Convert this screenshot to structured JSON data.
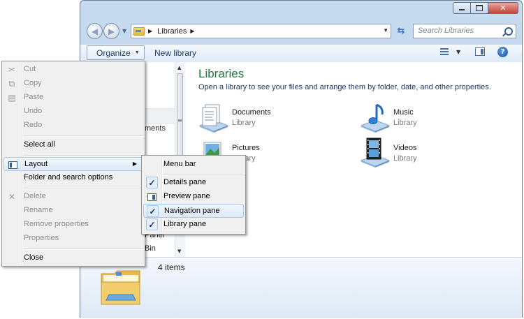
{
  "window": {
    "address_crumb": "Libraries",
    "search_placeholder": "Search Libraries"
  },
  "toolbar": {
    "organize_label": "Organize",
    "new_library_label": "New library"
  },
  "navigation": {
    "fragments": [
      "ments",
      "Panel",
      "Bin"
    ]
  },
  "content": {
    "title": "Libraries",
    "subtitle": "Open a library to see your files and arrange them by folder, date, and other properties.",
    "libraries": [
      {
        "name": "Documents",
        "type": "Library"
      },
      {
        "name": "Music",
        "type": "Library"
      },
      {
        "name": "Pictures",
        "type": "Library"
      },
      {
        "name": "Videos",
        "type": "Library"
      }
    ]
  },
  "details": {
    "item_count": "4 items"
  },
  "organize_menu": {
    "items": [
      {
        "label": "Cut",
        "enabled": false,
        "icon": "scissors-icon"
      },
      {
        "label": "Copy",
        "enabled": false,
        "icon": "copy-icon"
      },
      {
        "label": "Paste",
        "enabled": false,
        "icon": "paste-icon"
      },
      {
        "label": "Undo",
        "enabled": false
      },
      {
        "label": "Redo",
        "enabled": false
      },
      {
        "label": "Select all",
        "enabled": true
      },
      {
        "label": "Layout",
        "enabled": true,
        "icon": "layout-icon",
        "submenu": true
      },
      {
        "label": "Folder and search options",
        "enabled": true
      },
      {
        "label": "Delete",
        "enabled": false,
        "icon": "delete-icon"
      },
      {
        "label": "Rename",
        "enabled": false
      },
      {
        "label": "Remove properties",
        "enabled": false
      },
      {
        "label": "Properties",
        "enabled": false
      },
      {
        "label": "Close",
        "enabled": true
      }
    ]
  },
  "layout_submenu": {
    "items": [
      {
        "label": "Menu bar",
        "checked": false
      },
      {
        "label": "Details pane",
        "checked": true
      },
      {
        "label": "Preview pane",
        "checked": false
      },
      {
        "label": "Navigation pane",
        "checked": true
      },
      {
        "label": "Library pane",
        "checked": true
      }
    ]
  },
  "colors": {
    "title_green": "#1e7a3c",
    "link_blue": "#1e3a5f",
    "menu_bg": "#f0f0f0",
    "hover_border": "#a8c8ec"
  }
}
